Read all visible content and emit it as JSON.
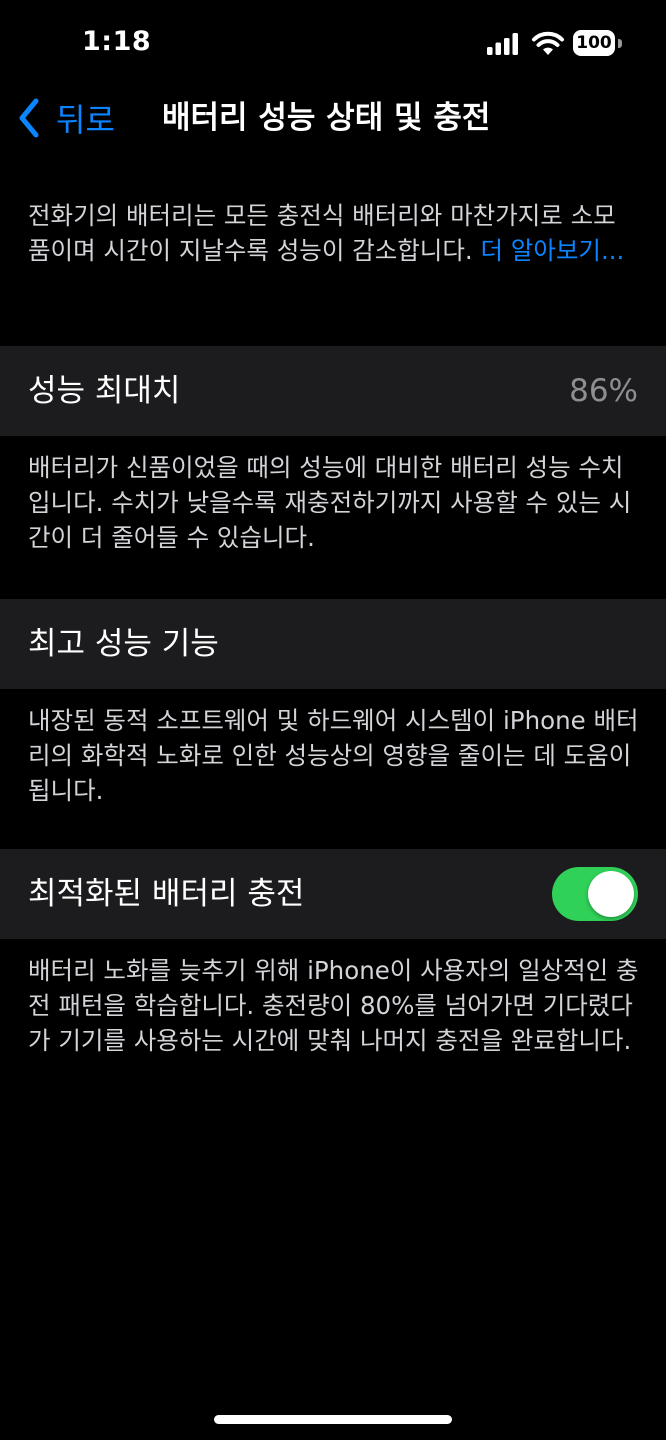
{
  "status_bar": {
    "time": "1:18",
    "battery_level": "100",
    "icons": [
      "cellular-signal-icon",
      "wifi-icon",
      "battery-icon"
    ]
  },
  "nav": {
    "back_label": "뒤로",
    "title": "배터리 성능 상태 및 충전"
  },
  "intro": {
    "text": "전화기의 배터리는 모든 충전식 배터리와 마찬가지로 소모품이며 시간이 지날수록 성능이 감소합니다. ",
    "link": "더 알아보기..."
  },
  "rows": [
    {
      "label": "성능 최대치",
      "value": "86%",
      "footer": "배터리가 신품이었을 때의 성능에 대비한 배터리 성능 수치입니다. 수치가 낮을수록 재충전하기까지 사용할 수 있는 시간이 더 줄어들 수 있습니다."
    },
    {
      "label": "최고 성능 기능",
      "footer": "내장된 동적 소프트웨어 및 하드웨어 시스템이 iPhone 배터리의 화학적 노화로 인한 성능상의 영향을 줄이는 데 도움이 됩니다."
    },
    {
      "label": "최적화된 배터리 충전",
      "toggle_on": true,
      "footer": "배터리 노화를 늦추기 위해 iPhone이 사용자의 일상적인 충전 패턴을 학습합니다. 충전량이 80%를 넘어가면 기다렸다가 기기를 사용하는 시간에 맞춰 나머지 충전을 완료합니다."
    }
  ],
  "colors": {
    "accent": "#0a84ff",
    "toggle_on": "#30d158",
    "cell_background": "#1c1c1e",
    "secondary_text": "#8e8e93"
  }
}
